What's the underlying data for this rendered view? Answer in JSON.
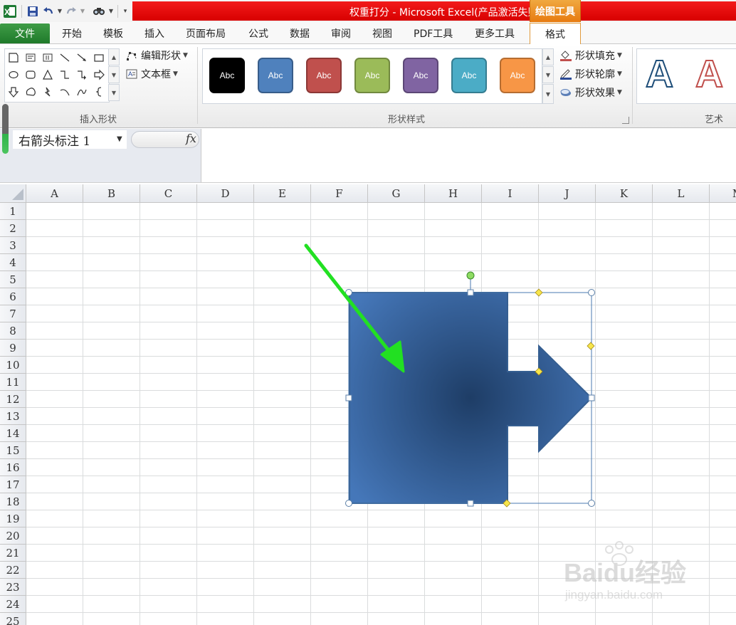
{
  "window": {
    "title": "权重打分 - Microsoft Excel(产品激活失败)",
    "context_tool": "绘图工具"
  },
  "quick_access": [
    "excel-logo-icon",
    "save-icon",
    "undo-icon",
    "redo-icon",
    "find-icon",
    "customize-qat-icon"
  ],
  "tabs": {
    "file": "文件",
    "items": [
      "开始",
      "模板",
      "插入",
      "页面布局",
      "公式",
      "数据",
      "审阅",
      "视图",
      "PDF工具",
      "更多工具"
    ],
    "active": "格式"
  },
  "ribbon": {
    "insert_shapes": {
      "label": "插入形状",
      "edit_shape": "编辑形状",
      "text_box": "文本框"
    },
    "shape_styles": {
      "label": "形状样式",
      "presets": [
        {
          "text": "Abc",
          "color": "#000000"
        },
        {
          "text": "Abc",
          "color": "#4f81bd"
        },
        {
          "text": "Abc",
          "color": "#c0504d"
        },
        {
          "text": "Abc",
          "color": "#9bbb59"
        },
        {
          "text": "Abc",
          "color": "#8064a2"
        },
        {
          "text": "Abc",
          "color": "#4bacc6"
        },
        {
          "text": "Abc",
          "color": "#f79646"
        }
      ],
      "fill": "形状填充",
      "outline": "形状轮廓",
      "effects": "形状效果"
    },
    "wordart": {
      "label": "艺术",
      "samples": [
        "A",
        "A"
      ]
    }
  },
  "formula_bar": {
    "name_box": "右箭头标注 1",
    "fx": "fx",
    "formula": ""
  },
  "sheet": {
    "columns": [
      "A",
      "B",
      "C",
      "D",
      "E",
      "F",
      "G",
      "H",
      "I",
      "J",
      "K",
      "L",
      "M"
    ],
    "rows": [
      "1",
      "2",
      "3",
      "4",
      "5",
      "6",
      "7",
      "8",
      "9",
      "10",
      "11",
      "12",
      "13",
      "14",
      "15",
      "16",
      "17",
      "18",
      "19",
      "20",
      "21",
      "22",
      "23",
      "24",
      "25"
    ]
  },
  "shape": {
    "type": "right-arrow-callout",
    "fill": "#4577b9",
    "fill_center": "#1e3d66",
    "outline": "#365f91"
  },
  "annotation": {
    "type": "arrow",
    "color": "#22e022"
  },
  "watermark": {
    "logo": "Baidu经验",
    "url": "jingyan.baidu.com"
  }
}
